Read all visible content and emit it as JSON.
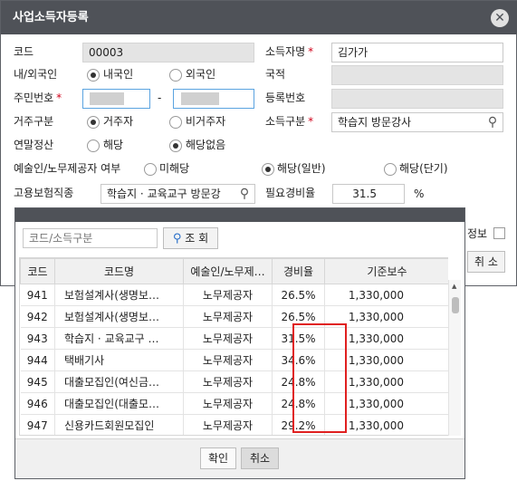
{
  "dialog": {
    "title": "사업소득자등록",
    "close_icon": "close-icon",
    "code_label": "코드",
    "code_value": "00003",
    "income_name_label": "소득자명",
    "income_name_value": "김가가",
    "nationality_type_label": "내/외국인",
    "domestic_label": "내국인",
    "foreign_label": "외국인",
    "nationality_label": "국적",
    "resident_no_label": "주민번호",
    "resident_no_dash": "-",
    "registration_no_label": "등록번호",
    "residency_label": "거주구분",
    "resident_label": "거주자",
    "nonresident_label": "비거주자",
    "income_type_label": "소득구분",
    "income_type_value": "학습지 방문강사",
    "year_end_label": "연말정산",
    "year_end_yes": "해당",
    "year_end_no": "해당없음",
    "artist_label": "예술인/노무제공자 여부",
    "artist_none": "미해당",
    "artist_general": "해당(일반)",
    "artist_short": "해당(단기)",
    "employment_label": "고용보험직종",
    "employment_value": "학습지 · 교육교구 방문강",
    "expense_rate_label": "필요경비율",
    "expense_rate_value": "31.5",
    "expense_rate_unit": "%",
    "hidden_info_label": "정보",
    "hidden_cancel_label": "취 소",
    "required_mark": "*"
  },
  "popup": {
    "search_placeholder": "코드/소득구분",
    "search_button_label": "조 회",
    "columns": [
      "코드",
      "코드명",
      "예술인/노무제…",
      "경비율",
      "기준보수"
    ],
    "rows": [
      {
        "code": "941",
        "name": "보험설계사(생명보…",
        "type": "노무제공자",
        "rate": "26.5%",
        "base": "1,330,000"
      },
      {
        "code": "942",
        "name": "보험설계사(생명보…",
        "type": "노무제공자",
        "rate": "26.5%",
        "base": "1,330,000"
      },
      {
        "code": "943",
        "name": "학습지 · 교육교구 …",
        "type": "노무제공자",
        "rate": "31.5%",
        "base": "1,330,000"
      },
      {
        "code": "944",
        "name": "택배기사",
        "type": "노무제공자",
        "rate": "34.6%",
        "base": "1,330,000"
      },
      {
        "code": "945",
        "name": "대출모집인(여신금…",
        "type": "노무제공자",
        "rate": "24.8%",
        "base": "1,330,000"
      },
      {
        "code": "946",
        "name": "대출모집인(대출모…",
        "type": "노무제공자",
        "rate": "24.8%",
        "base": "1,330,000"
      },
      {
        "code": "947",
        "name": "신용카드회원모집인",
        "type": "노무제공자",
        "rate": "29.2%",
        "base": "1,330,000"
      }
    ],
    "ok_label": "확인",
    "cancel_label": "취소",
    "highlight_color": "#e02020"
  }
}
